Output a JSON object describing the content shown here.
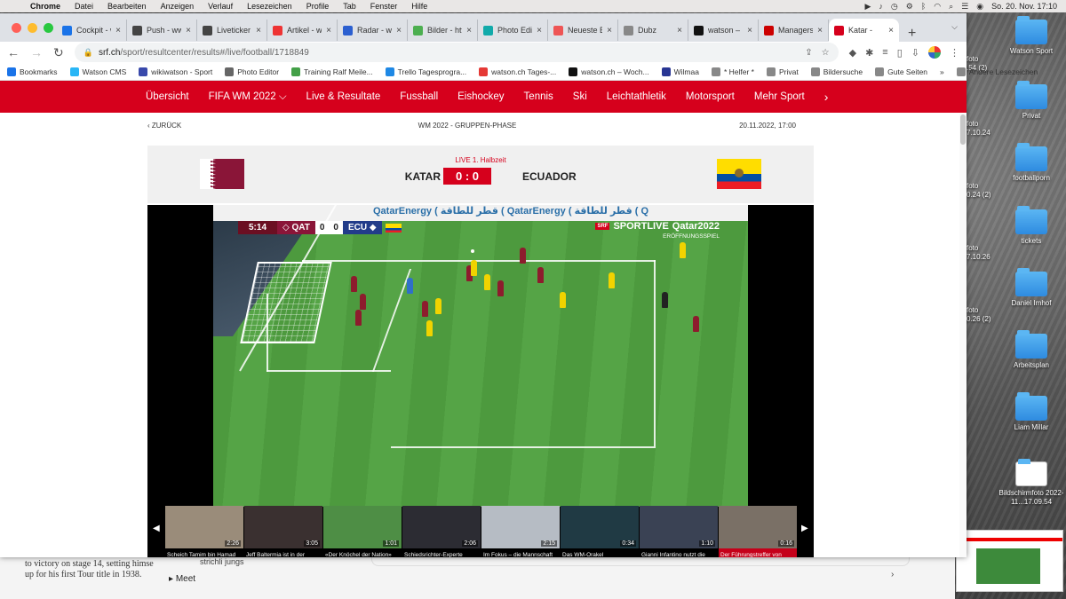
{
  "menubar": {
    "app": "Chrome",
    "items": [
      "Datei",
      "Bearbeiten",
      "Anzeigen",
      "Verlauf",
      "Lesezeichen",
      "Profile",
      "Tab",
      "Fenster",
      "Hilfe"
    ],
    "clock": "So. 20. Nov.  17:10"
  },
  "tabs": [
    {
      "label": "Cockpit - w",
      "color": "#1a73e8"
    },
    {
      "label": "Push - www",
      "color": "#444"
    },
    {
      "label": "Liveticker",
      "color": "#444"
    },
    {
      "label": "Artikel - w",
      "color": "#e33"
    },
    {
      "label": "Radar - ww",
      "color": "#2b5fd0"
    },
    {
      "label": "Bilder - htt",
      "color": "#4caf50"
    },
    {
      "label": "Photo Edit",
      "color": "#1aa"
    },
    {
      "label": "Neueste E",
      "color": "#e55"
    },
    {
      "label": "Dubz",
      "color": "#888"
    },
    {
      "label": "watson – N",
      "color": "#111"
    },
    {
      "label": "Managersp",
      "color": "#c00"
    },
    {
      "label": "Katar -",
      "color": "#d6001c",
      "active": true
    }
  ],
  "url": {
    "host": "srf.ch",
    "path": "/sport/resultcenter/results#/live/football/1718849"
  },
  "bookmarks": [
    {
      "label": "Bookmarks",
      "color": "#1a73e8"
    },
    {
      "label": "Watson CMS",
      "color": "#29b6f6"
    },
    {
      "label": "wikiwatson - Sport",
      "color": "#3949ab"
    },
    {
      "label": "Photo Editor",
      "color": "#666"
    },
    {
      "label": "Training Ralf Meile...",
      "color": "#43a047"
    },
    {
      "label": "Trello Tagesprogra...",
      "color": "#1e88e5"
    },
    {
      "label": "watson.ch Tages-...",
      "color": "#e53935"
    },
    {
      "label": "watson.ch – Woch...",
      "color": "#111"
    },
    {
      "label": "Wilmaa",
      "color": "#283593"
    },
    {
      "label": "* Helfer *",
      "color": "#888"
    },
    {
      "label": "Privat",
      "color": "#888"
    },
    {
      "label": "Bildersuche",
      "color": "#888"
    },
    {
      "label": "Gute Seiten",
      "color": "#888"
    }
  ],
  "bookmarks_more": "»",
  "bookmarks_other": "Andere Lesezeichen",
  "srfnav": {
    "items": [
      "Übersicht",
      "FIFA WM 2022 ⌵",
      "Live & Resultate",
      "Fussball",
      "Eishockey",
      "Tennis",
      "Ski",
      "Leichtathletik",
      "Motorsport",
      "Mehr Sport"
    ],
    "arrow": "›"
  },
  "match": {
    "back": "‹ ZURÜCK",
    "phase": "WM 2022 - GRUPPEN-PHASE",
    "datetime": "20.11.2022, 17:00",
    "status": "LIVE 1. Halbzeit",
    "home": "KATAR",
    "away": "ECUADOR",
    "score": "0 : 0"
  },
  "broadcast": {
    "clock": "5:14",
    "home_code": "◇ QAT",
    "home_score": "0",
    "away_score": "0",
    "away_code": "ECU ◆",
    "ad_text": "QatarEnergy ( قطر للطاقة ( QatarEnergy ( قطر للطاقة ( Q",
    "channel": "SPORTLIVE",
    "channel_badge": "SRF",
    "event": "Qatar2022",
    "event_sub": "ERÖFFNUNGSSPIEL"
  },
  "clips": [
    {
      "caption": "Scheich Tamim bin Hamad al-Thani wendet sich an die",
      "duration": "2:26",
      "bg": "#9a8c7a"
    },
    {
      "caption": "Jeff Baltermia ist in der Fanmeile unterwegs",
      "duration": "3:05",
      "bg": "#3a3030"
    },
    {
      "caption": "«Der Knöchel der Nation»",
      "duration": "1:01",
      "bg": "#4e8e45"
    },
    {
      "caption": "Schiedsrichter-Experte Sascha Amhof",
      "duration": "2:06",
      "bg": "#2c2c33"
    },
    {
      "caption": "Im Fokus – die Mannschaft von Katar",
      "duration": "2:15",
      "bg": "#b6bcc4"
    },
    {
      "caption": "Das WM-Orakel",
      "duration": "0:34",
      "bg": "#203a44"
    },
    {
      "caption": "Gianni Infantino nutzt die Chance sich mit Worten an",
      "duration": "1:10",
      "bg": "#3a4254"
    },
    {
      "caption": "Der Führungstreffer von Ecuador zählt nicht!",
      "duration": "0:16",
      "bg": "#7a7066",
      "active": true
    }
  ],
  "desktop": [
    {
      "label": "Watson Sport"
    },
    {
      "label": "Privat"
    },
    {
      "label": "footballporn"
    },
    {
      "label": "tickets"
    },
    {
      "label": "Daniel Imhof"
    },
    {
      "label": "Arbeitsplan"
    },
    {
      "label": "Liam Millar"
    },
    {
      "label": "Bildschirmfoto 2022-11...17.09.54"
    }
  ],
  "desktop_partial": [
    "foto",
    ".54 (2)",
    "foto",
    "7.10.24",
    "foto",
    "0.24 (2)",
    "foto",
    "7.10.26",
    "foto",
    "0.26 (2)"
  ],
  "bgwin": {
    "story_line1": "to victory on stage 14, setting himse",
    "story_line2": "up for his first Tour title in 1938.",
    "strichli": "strichli jungs",
    "meet": "Meet",
    "chev": "›"
  }
}
